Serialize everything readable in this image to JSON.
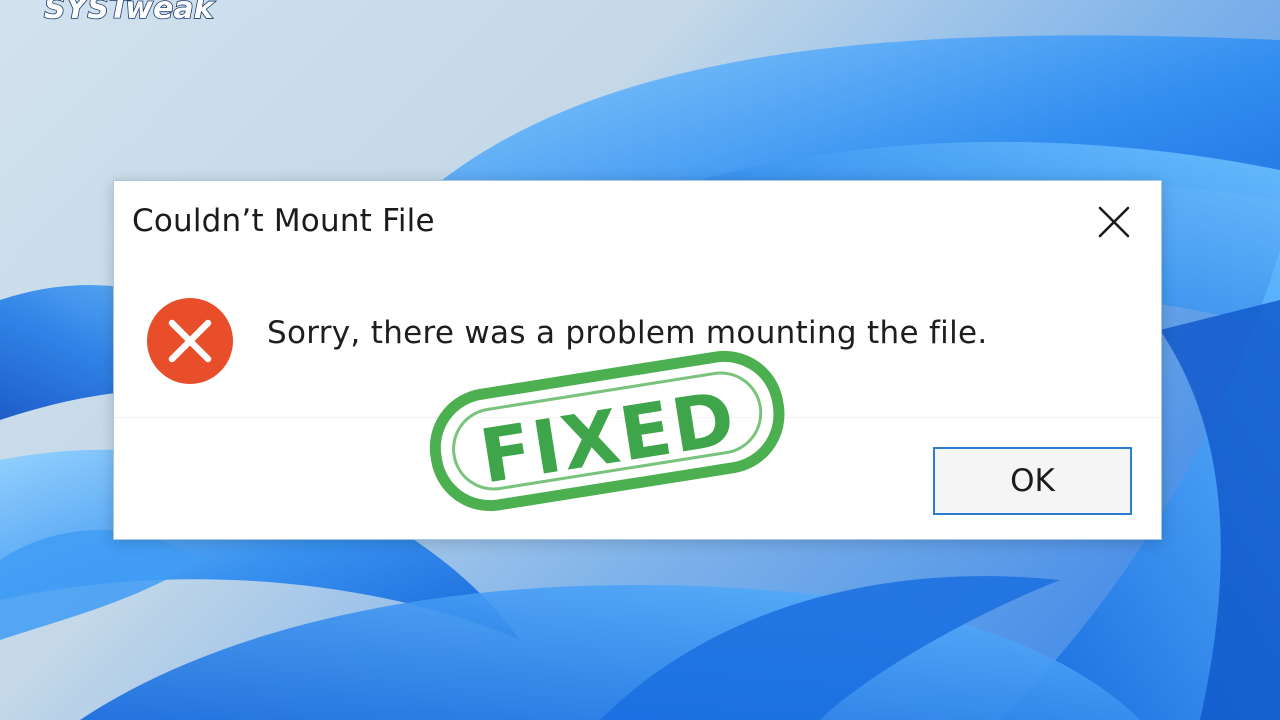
{
  "brand": {
    "logo_text": "SYSTweak"
  },
  "dialog": {
    "title": "Couldn’t Mount File",
    "close_icon": "close-icon",
    "error_icon": "error-icon",
    "message": "Sorry, there was a problem mounting the file.",
    "ok_label": "OK"
  },
  "stamp": {
    "text": "FIXED",
    "color": "#4caf50"
  },
  "colors": {
    "error_red": "#e94e2b",
    "button_border": "#2a7fd1",
    "wallpaper_blue": "#2f7de6"
  }
}
